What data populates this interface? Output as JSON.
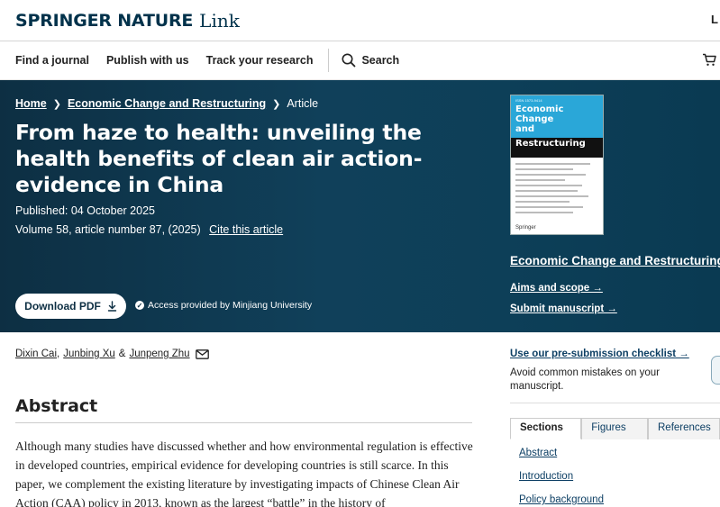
{
  "header": {
    "brand": "SPRINGER NATURE",
    "brand_suffix": "Link",
    "login_partial": "L"
  },
  "nav": {
    "items": [
      "Find a journal",
      "Publish with us",
      "Track your research"
    ],
    "search_label": "Search"
  },
  "breadcrumb": {
    "home": "Home",
    "journal": "Economic Change and Restructuring",
    "current": "Article"
  },
  "article": {
    "title": "From haze to health: unveiling the health benefits of clean air action-evidence in China",
    "published": "Published: 04 October 2025",
    "volume": "Volume 58, article number 87, (2025)",
    "cite": "Cite this article",
    "download": "Download PDF",
    "access": "Access provided by Minjiang University"
  },
  "cover": {
    "issn": "ISSN 1573-9414",
    "title_line1": "Economic\nChange\nand",
    "title_line2": "Restructuring",
    "publisher": "Springer"
  },
  "journal_panel": {
    "name": "Economic Change and Restructuring",
    "aims": "Aims and scope →",
    "submit": "Submit manuscript →"
  },
  "authors": {
    "a1": "Dixin Cai",
    "a2": "Junbing Xu",
    "amp": "&",
    "a3": "Junpeng Zhu"
  },
  "abstract": {
    "heading": "Abstract",
    "text": "Although many studies have discussed whether and how environmental regulation is effective in developed countries, empirical evidence for developing countries is still scarce. In this paper, we complement the existing literature by investigating impacts of Chinese Clean Air Action (CAA) policy in 2013, known as the largest “battle” in the history of"
  },
  "sidebar": {
    "checklist": "Use our pre-submission checklist →",
    "checklist_sub": "Avoid common mistakes on your manuscript.",
    "tabs": [
      "Sections",
      "Figures",
      "References"
    ],
    "sections": [
      "Abstract",
      "Introduction",
      "Policy background"
    ]
  },
  "colors": {
    "hero_bg": "#10405a",
    "brand_navy": "#01324b",
    "link_blue": "#0d3f64"
  }
}
